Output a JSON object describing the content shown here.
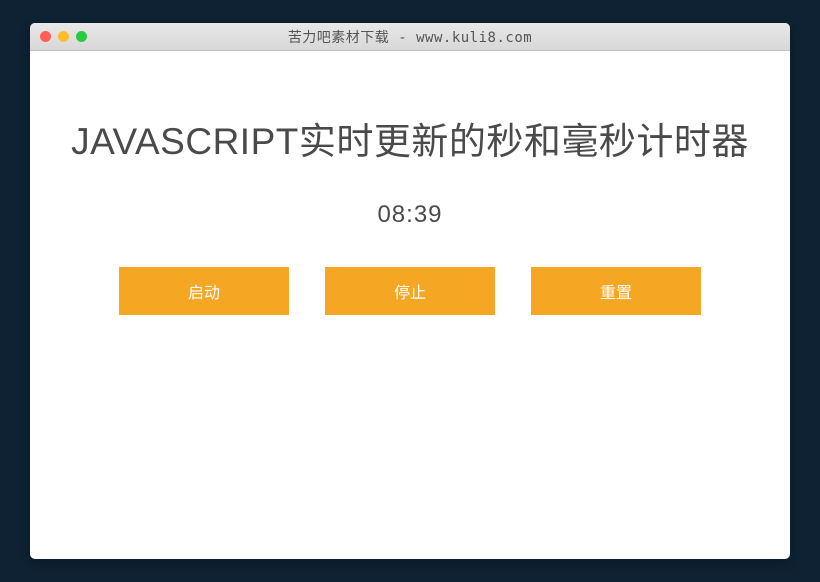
{
  "titlebar": {
    "title": "苦力吧素材下载 - www.kuli8.com"
  },
  "heading": "JAVASCRIPT实时更新的秒和毫秒计时器",
  "timer": {
    "seconds": "08",
    "separator": ":",
    "centiseconds": "39"
  },
  "buttons": {
    "start": "启动",
    "stop": "停止",
    "reset": "重置"
  }
}
